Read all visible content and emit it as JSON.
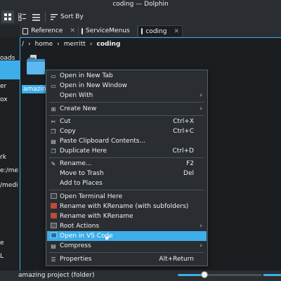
{
  "window": {
    "title": "coding — Dolphin"
  },
  "toolbar": {
    "sort_label": "Sort By"
  },
  "tabs": [
    {
      "label": "Reference",
      "active": false
    },
    {
      "label": "ServiceMenus",
      "active": false
    },
    {
      "label": "coding",
      "active": true
    }
  ],
  "sidebar_fragments": [
    "oads",
    "er",
    "ox",
    "rk",
    "e:/me",
    "/medi",
    "e",
    "L"
  ],
  "breadcrumb": {
    "root": "/",
    "parts": [
      "home",
      "merritt",
      "coding"
    ]
  },
  "folder": {
    "label": "amazing"
  },
  "context_menu": {
    "items": [
      {
        "label": "Open in New Tab",
        "icon": "tab-icon"
      },
      {
        "label": "Open in New Window",
        "icon": "window-icon"
      },
      {
        "label": "Open With",
        "icon": "open-with-icon",
        "submenu": true
      },
      {
        "label": "Create New",
        "icon": "plus-icon",
        "submenu": true
      },
      {
        "label": "Cut",
        "icon": "scissors-icon",
        "shortcut": "Ctrl+X"
      },
      {
        "label": "Copy",
        "icon": "copy-icon",
        "shortcut": "Ctrl+C"
      },
      {
        "label": "Paste Clipboard Contents...",
        "icon": "paste-icon"
      },
      {
        "label": "Duplicate Here",
        "icon": "duplicate-icon",
        "shortcut": "Ctrl+D"
      },
      {
        "label": "Rename...",
        "icon": "rename-icon",
        "shortcut": "F2"
      },
      {
        "label": "Move to Trash",
        "icon": "trash-icon",
        "shortcut": "Del"
      },
      {
        "label": "Add to Places",
        "icon": "places-icon"
      },
      {
        "label": "Open Terminal Here",
        "icon": "terminal-icon"
      },
      {
        "label": "Rename with KRename (with subfolders)",
        "icon": "krename-icon"
      },
      {
        "label": "Rename with KRename",
        "icon": "krename-icon"
      },
      {
        "label": "Root Actions",
        "icon": "root-actions-icon",
        "submenu": true
      },
      {
        "label": "Open in VS Code",
        "icon": "vscode-icon",
        "highlighted": true
      },
      {
        "label": "Compress",
        "icon": "compress-icon",
        "submenu": true
      },
      {
        "label": "Properties",
        "icon": "properties-icon",
        "shortcut": "Alt+Return"
      }
    ]
  },
  "statusbar": {
    "text": "amazing project (folder)"
  },
  "colors": {
    "accent": "#3daee9",
    "window_bg": "#232629",
    "view_bg": "#1b1e20"
  }
}
